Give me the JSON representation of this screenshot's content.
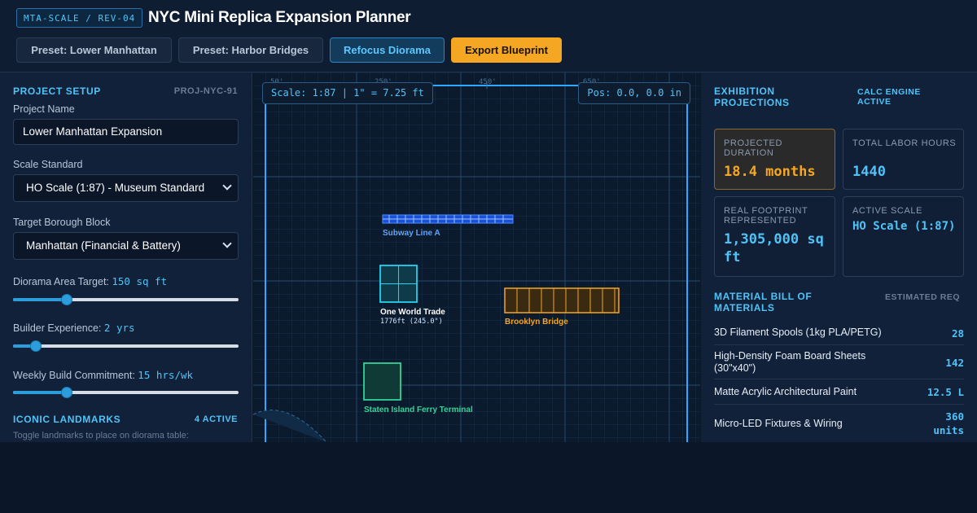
{
  "header": {
    "badge": "MTA-SCALE / REV-04",
    "title": "NYC Mini Replica Expansion Planner",
    "buttons": {
      "preset_lower_manhattan": "Preset: Lower Manhattan",
      "preset_harbor_bridges": "Preset: Harbor Bridges",
      "refocus": "Refocus Diorama",
      "export": "Export Blueprint"
    }
  },
  "setup": {
    "title": "PROJECT SETUP",
    "project_id": "PROJ-NYC-91",
    "project_name_label": "Project Name",
    "project_name_value": "Lower Manhattan Expansion",
    "scale_label": "Scale Standard",
    "scale_value": "HO Scale (1:87) - Museum Standard",
    "borough_label": "Target Borough Block",
    "borough_value": "Manhattan (Financial & Battery)",
    "area_label": "Diorama Area Target:",
    "area_value": "150 sq ft",
    "area_fraction": 0.24,
    "experience_label": "Builder Experience:",
    "experience_value": "2 yrs",
    "experience_fraction": 0.1,
    "commitment_label": "Weekly Build Commitment:",
    "commitment_value": "15 hrs/wk",
    "commitment_fraction": 0.24
  },
  "landmarks": {
    "title": "ICONIC LANDMARKS",
    "active": "4 ACTIVE",
    "hint": "Toggle landmarks to place on diorama table:"
  },
  "canvas": {
    "scale_readout": "Scale: 1:87 | 1\" = 7.25 ft",
    "pos_readout": "Pos: 0.0, 0.0 in",
    "ruler_ticks": [
      "50'",
      "250'",
      "450'",
      "650'"
    ],
    "pieces": {
      "subway": "Subway Line A",
      "wtc": "One World Trade",
      "wtc_sub": "1776ft (245.0\")",
      "bridge": "Brooklyn Bridge",
      "ferry": "Staten Island Ferry Terminal"
    },
    "colors": {
      "subway": "#3b82f6",
      "wtc": "#22d3ee",
      "bridge": "#f5a623",
      "ferry": "#34d399",
      "frame": "#2fa8ff"
    }
  },
  "projections": {
    "title": "EXHIBITION PROJECTIONS",
    "engine_status": "CALC ENGINE ACTIVE",
    "cards": {
      "duration_label": "PROJECTED DURATION",
      "duration_value": "18.4 months",
      "labor_label": "TOTAL LABOR HOURS",
      "labor_value": "1440",
      "footprint_label": "REAL FOOTPRINT REPRESENTED",
      "footprint_value": "1,305,000 sq ft",
      "scale_label": "ACTIVE SCALE",
      "scale_value": "HO Scale (1:87)"
    }
  },
  "bom": {
    "title": "MATERIAL BILL OF MATERIALS",
    "column": "ESTIMATED REQ",
    "rows": [
      {
        "name": "3D Filament Spools (1kg PLA/PETG)",
        "qty": "28"
      },
      {
        "name": "High-Density Foam Board Sheets (30\"x40\")",
        "qty": "142"
      },
      {
        "name": "Matte Acrylic Architectural Paint",
        "qty": "12.5 L"
      },
      {
        "name": "Micro-LED Fixtures & Wiring",
        "qty": "360 units"
      }
    ]
  }
}
